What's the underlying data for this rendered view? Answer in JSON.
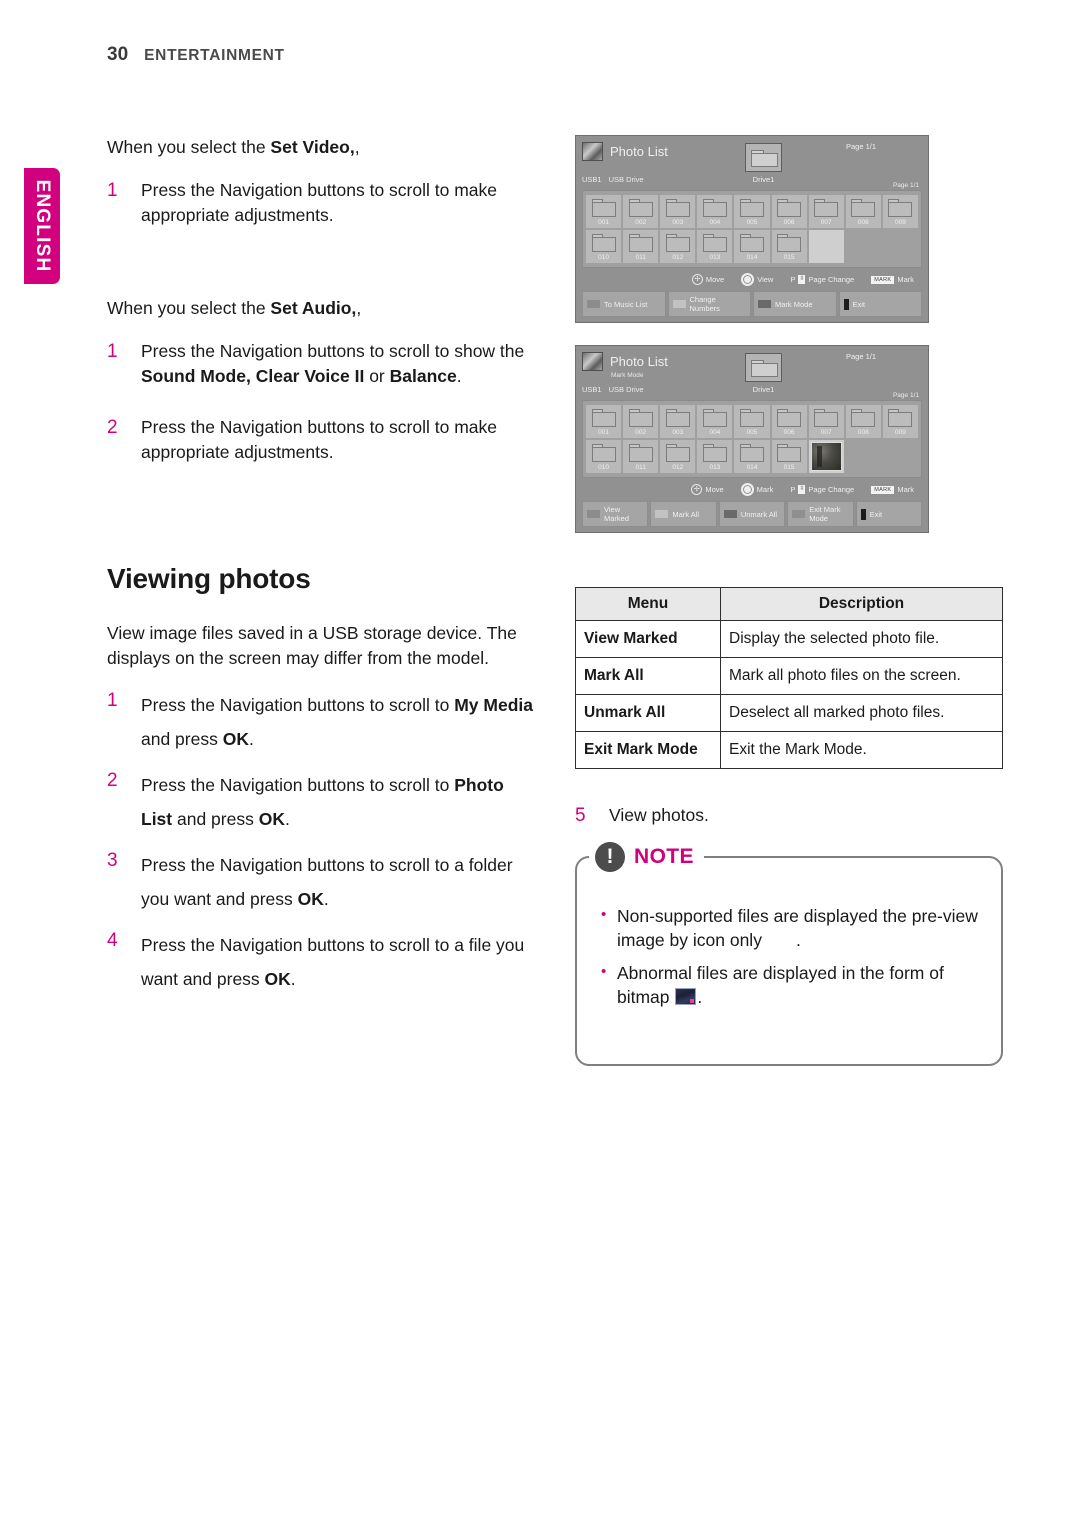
{
  "header": {
    "page_number": "30",
    "section": "ENTERTAINMENT"
  },
  "side_tab": {
    "label": "ENGLISH",
    "color": "#d2007e"
  },
  "left_column": {
    "set_video_intro_plain": "When you select the ",
    "set_video_intro_bold": "Set Video,",
    "set_video_intro_tail": ",",
    "set_video_step_num": "1",
    "set_video_step_text": "Press the Navigation buttons to scroll to make appropriate adjustments.",
    "set_audio_intro_plain": "When you select the ",
    "set_audio_intro_bold": "Set Audio,",
    "set_audio_intro_tail": ",",
    "set_audio_step1_num": "1",
    "set_audio_step1_a": "Press the Navigation buttons to scroll to show the ",
    "set_audio_step1_b": "Sound Mode, Clear Voice II",
    "set_audio_step1_c": " or ",
    "set_audio_step1_d": "Balance",
    "set_audio_step1_e": ".",
    "set_audio_step2_num": "2",
    "set_audio_step2_text": "Press the Navigation buttons to scroll to make appropriate adjustments.",
    "section_title": "Viewing photos",
    "intro": "View image files saved in a USB storage device. The displays on the screen may differ from the model.",
    "steps": [
      {
        "num": "1",
        "a": "Press the Navigation buttons to scroll to ",
        "b": "My Media",
        "c": " and press ",
        "d": "OK",
        "e": "."
      },
      {
        "num": "2",
        "a": "Press the Navigation buttons to scroll to ",
        "b": "Photo List",
        "c": " and press ",
        "d": "OK",
        "e": "."
      },
      {
        "num": "3",
        "a": "Press the Navigation buttons to scroll to a folder you want and press ",
        "b": "",
        "c": "",
        "d": "OK",
        "e": "."
      },
      {
        "num": "4",
        "a": "Press the Navigation buttons to scroll to a file you want and press ",
        "b": "",
        "c": "",
        "d": "OK",
        "e": "."
      }
    ]
  },
  "screenshot_1": {
    "app_title": "Photo List",
    "sub_mode": "",
    "source_device": "USB1",
    "source_name": "USB Drive",
    "current_folder": "Drive1",
    "page_top": "Page 1/1",
    "page_right": "Page 1/1",
    "folders_row1": [
      "001",
      "002",
      "003",
      "004",
      "005",
      "006",
      "007",
      "008",
      "009"
    ],
    "folders_row2": [
      "010",
      "011",
      "012",
      "013",
      "014",
      "015"
    ],
    "selected_cell_kind": "empty-selected",
    "hints": [
      {
        "icon": "dpad-icon",
        "label": "Move"
      },
      {
        "icon": "ok-button-icon",
        "label": "View"
      },
      {
        "icon": "page-updown-icon",
        "prefix": "P",
        "label": "Page Change"
      },
      {
        "icon": "mark-chip-icon",
        "chip": "MARK",
        "label": "Mark"
      }
    ],
    "buttons": [
      {
        "color": "red",
        "label": "To Music List"
      },
      {
        "color": "green",
        "label": "Change Numbers"
      },
      {
        "color": "yellow",
        "label": "Mark Mode"
      },
      {
        "color": "exit",
        "label": "Exit"
      }
    ]
  },
  "screenshot_2": {
    "app_title": "Photo List",
    "sub_mode": "Mark Mode",
    "source_device": "USB1",
    "source_name": "USB Drive",
    "current_folder": "Drive1",
    "page_top": "Page 1/1",
    "page_right": "Page 1/1",
    "folders_row1": [
      "001",
      "002",
      "003",
      "004",
      "005",
      "006",
      "007",
      "008",
      "009"
    ],
    "folders_row2": [
      "010",
      "011",
      "012",
      "013",
      "014",
      "015"
    ],
    "selected_cell_kind": "photo-thumbnail",
    "hints": [
      {
        "icon": "dpad-icon",
        "label": "Move"
      },
      {
        "icon": "ok-button-icon",
        "label": "Mark"
      },
      {
        "icon": "page-updown-icon",
        "prefix": "P",
        "label": "Page Change"
      },
      {
        "icon": "mark-chip-icon",
        "chip": "MARK",
        "label": "Mark"
      }
    ],
    "buttons": [
      {
        "color": "red",
        "label": "View Marked"
      },
      {
        "color": "green",
        "label": "Mark All"
      },
      {
        "color": "yellow",
        "label": "Unmark All"
      },
      {
        "color": "blue",
        "label": "Exit Mark Mode"
      },
      {
        "color": "exit",
        "label": "Exit"
      }
    ]
  },
  "menu_table": {
    "columns": [
      "Menu",
      "Description"
    ],
    "rows": [
      {
        "menu": "View Marked",
        "description": "Display the selected photo file."
      },
      {
        "menu": "Mark All",
        "description": "Mark all photo files on the screen."
      },
      {
        "menu": "Unmark All",
        "description": "Deselect all marked photo files."
      },
      {
        "menu": "Exit Mark Mode",
        "description": "Exit the Mark Mode."
      }
    ]
  },
  "right_column": {
    "step5_num": "5",
    "step5_text": "View photos."
  },
  "note": {
    "title": "NOTE",
    "badge": "!",
    "items": [
      {
        "a": "Non-supported files are displayed the pre-view image by icon only",
        "icon": "unsupported-file-icon",
        "b": "."
      },
      {
        "a": "Abnormal files are displayed in the form of bitmap",
        "icon": "bitmap-file-icon",
        "b": "."
      }
    ]
  }
}
